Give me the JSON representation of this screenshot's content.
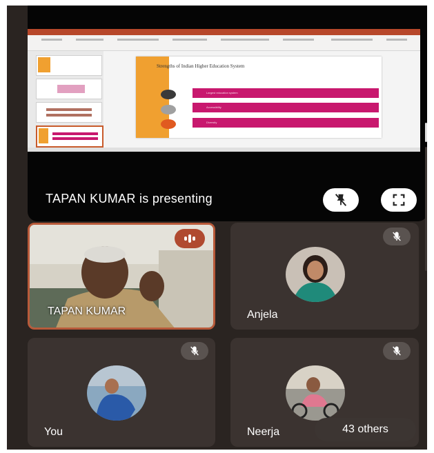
{
  "presentation": {
    "label": "TAPAN KUMAR is presenting",
    "slide_title": "Strengths of Indian Higher Education System",
    "slide_bullets": [
      "Largest education system",
      "Accessibility",
      "Diversity"
    ]
  },
  "participants": [
    {
      "name": "TAPAN KUMAR",
      "state": "speaking"
    },
    {
      "name": "Anjela",
      "state": "muted"
    },
    {
      "name": "You",
      "state": "muted"
    },
    {
      "name": "Neerja",
      "state": "muted"
    }
  ],
  "others_label": "43 others",
  "icons": {
    "unpin": "unpin-icon",
    "fullscreen": "fullscreen-icon",
    "mic_off": "mic-off-icon",
    "audio_wave": "audio-wave-icon"
  },
  "colors": {
    "background": "#2a2421",
    "tile": "#3b3330",
    "speaking_border": "#b85a3a",
    "speaking_badge": "#b04a30",
    "slide_accent": "#c8186e",
    "slide_stripe": "#f0a030"
  }
}
